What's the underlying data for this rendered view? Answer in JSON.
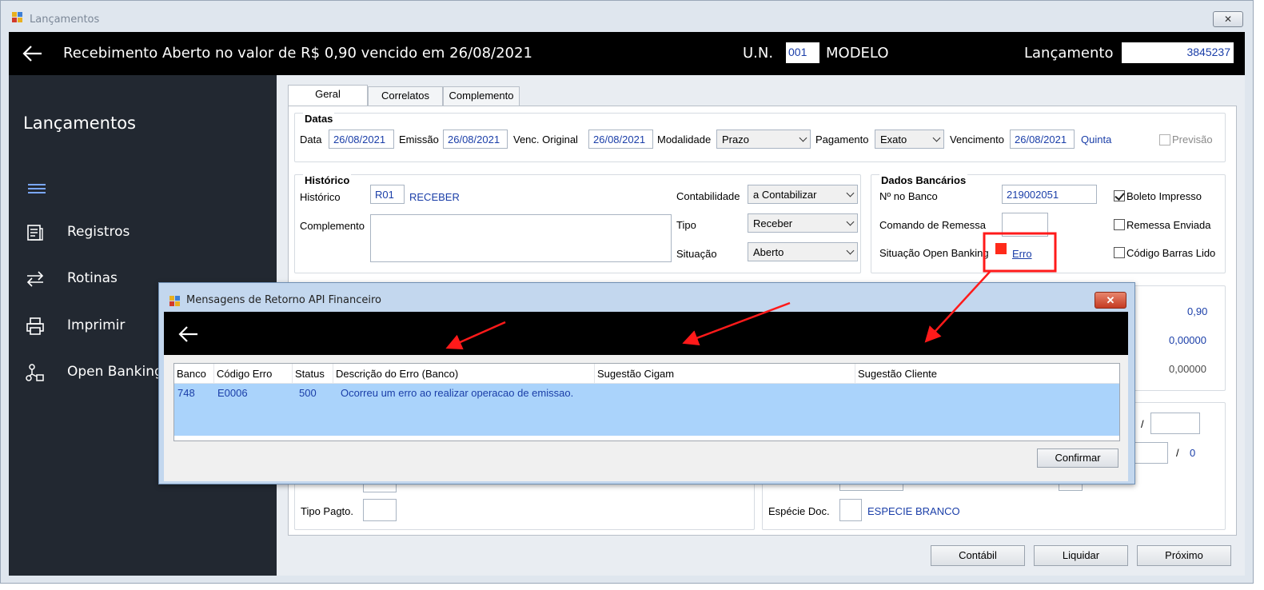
{
  "window": {
    "title": "Lançamentos",
    "close_glyph": "✕"
  },
  "header": {
    "title": "Recebimento Aberto no valor de R$ 0,90 vencido em 26/08/2021",
    "un_label": "U.N.",
    "un_value": "001",
    "un_name": "MODELO",
    "lanc_label": "Lançamento",
    "lanc_value": "3845237"
  },
  "sidebar": {
    "title": "Lançamentos",
    "items": [
      {
        "label": "Registros",
        "icon": "registros-icon"
      },
      {
        "label": "Rotinas",
        "icon": "swap-icon"
      },
      {
        "label": "Imprimir",
        "icon": "printer-icon"
      },
      {
        "label": "Open Banking",
        "icon": "network-icon"
      }
    ]
  },
  "tabs": [
    "Geral",
    "Correlatos",
    "Complemento"
  ],
  "datas": {
    "title": "Datas",
    "data_label": "Data",
    "data_value": "26/08/2021",
    "emissao_label": "Emissão",
    "emissao_value": "26/08/2021",
    "venc_orig_label": "Venc. Original",
    "venc_orig_value": "26/08/2021",
    "modalidade_label": "Modalidade",
    "modalidade_value": "Prazo",
    "pagamento_label": "Pagamento",
    "pagamento_value": "Exato",
    "vencimento_label": "Vencimento",
    "vencimento_value": "26/08/2021",
    "dia_semana": "Quinta",
    "previsao_label": "Previsão"
  },
  "historico": {
    "title": "Histórico",
    "historico_label": "Histórico",
    "codigo": "R01",
    "descricao": "RECEBER",
    "complemento_label": "Complemento",
    "complemento_value": "",
    "contabilidade_label": "Contabilidade",
    "contabilidade_value": "a Contabilizar",
    "tipo_label": "Tipo",
    "tipo_value": "Receber",
    "situacao_label": "Situação",
    "situacao_value": "Aberto"
  },
  "dados_bancarios": {
    "title": "Dados Bancários",
    "no_banco_label": "Nº no Banco",
    "no_banco_value": "219002051",
    "comando_label": "Comando de Remessa",
    "comando_value": "",
    "situacao_ob_label": "Situação Open Banking",
    "situacao_ob_value": "Erro",
    "boleto_label": "Boleto Impresso",
    "remessa_label": "Remessa Enviada",
    "codigo_barras_label": "Código Barras Lido"
  },
  "valores": [
    "0,90",
    "0,00000",
    "0,00000"
  ],
  "lower": {
    "slash1": "/",
    "slash2": "/",
    "zero": "0",
    "tipo_pagto_label": "Tipo Pagto.",
    "especie_label": "Espécie Doc.",
    "especie_value": "ESPECIE BRANCO"
  },
  "buttons": {
    "contabil": "Contábil",
    "liquidar": "Liquidar",
    "proximo": "Próximo"
  },
  "dialog": {
    "title": "Mensagens de Retorno API Financeiro",
    "close_glyph": "✕",
    "columns": [
      "Banco",
      "Código Erro",
      "Status",
      "Descrição do Erro (Banco)",
      "Sugestão Cigam",
      "Sugestão Cliente"
    ],
    "rows": [
      [
        "748",
        "E0006",
        "500",
        "Ocorreu um erro ao realizar operacao de emissao.",
        "",
        ""
      ]
    ],
    "confirm_label": "Confirmar"
  },
  "colors": {
    "accent_blue": "#1a3ea8",
    "error_red": "#ff2a1a",
    "sidebar_bg": "#222831",
    "selection": "#aad3fb"
  }
}
